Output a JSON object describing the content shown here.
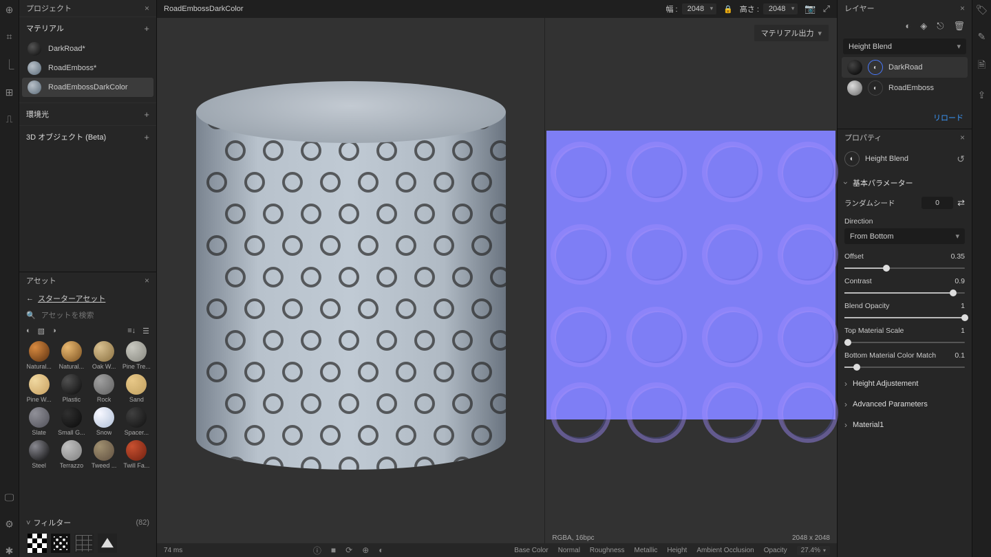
{
  "project": {
    "title": "プロジェクト",
    "materials_header": "マテリアル",
    "materials": [
      {
        "name": "DarkRoad*",
        "swatch": "dark"
      },
      {
        "name": "RoadEmboss*",
        "swatch": "slate"
      },
      {
        "name": "RoadEmbossDarkColor",
        "swatch": "slate",
        "selected": true
      }
    ],
    "env_header": "環境光",
    "obj3d_header": "3D オブジェクト (Beta)"
  },
  "assets": {
    "title": "アセット",
    "back": "スターターアセット",
    "search_placeholder": "アセットを検索",
    "items": [
      {
        "name": "Natural...",
        "cls": "th-natural1"
      },
      {
        "name": "Natural...",
        "cls": "th-natural2"
      },
      {
        "name": "Oak W...",
        "cls": "th-oak"
      },
      {
        "name": "Pine Tre...",
        "cls": "th-pinetre"
      },
      {
        "name": "Pine W...",
        "cls": "th-pinew"
      },
      {
        "name": "Plastic",
        "cls": "th-plastic"
      },
      {
        "name": "Rock",
        "cls": "th-rock"
      },
      {
        "name": "Sand",
        "cls": "th-sand"
      },
      {
        "name": "Slate",
        "cls": "th-slate"
      },
      {
        "name": "Small G...",
        "cls": "th-smallg"
      },
      {
        "name": "Snow",
        "cls": "th-snow"
      },
      {
        "name": "Spacer...",
        "cls": "th-spacer"
      },
      {
        "name": "Steel",
        "cls": "th-steel"
      },
      {
        "name": "Terrazzo",
        "cls": "th-terrazzo"
      },
      {
        "name": "Tweed ...",
        "cls": "th-tweed"
      },
      {
        "name": "Twill Fa...",
        "cls": "th-twill"
      }
    ],
    "filters_label": "フィルター",
    "filters_count": "(82)"
  },
  "topbar": {
    "doc_name": "RoadEmbossDarkColor",
    "width_label": "幅 :",
    "width_val": "2048",
    "height_label": "高さ :",
    "height_val": "2048"
  },
  "viewport2d": {
    "material_output": "マテリアル出力",
    "pixel_format": "RGBA, 16bpc",
    "resolution": "2048 x 2048"
  },
  "bottombar": {
    "render_time": "74 ms",
    "channels": {
      "base_color": "Base Color",
      "normal": "Normal",
      "roughness": "Roughness",
      "metallic": "Metallic",
      "height": "Height",
      "ao": "Ambient Occlusion",
      "opacity": "Opacity"
    },
    "opacity_pct": "27.4%"
  },
  "layers": {
    "title": "レイヤー",
    "blend_mode": "Height Blend",
    "items": [
      {
        "name": "DarkRoad",
        "active": true,
        "dark": true,
        "selected_slot": true
      },
      {
        "name": "RoadEmboss",
        "active": false,
        "dark": false,
        "selected_slot": false
      }
    ],
    "reload": "リロード"
  },
  "properties": {
    "title": "プロパティ",
    "name": "Height Blend",
    "group_basic": "基本パラメーター",
    "random_seed_label": "ランダムシード",
    "random_seed_val": "0",
    "direction_label": "Direction",
    "direction_val": "From Bottom",
    "sliders": [
      {
        "label": "Offset",
        "val": "0.35",
        "pct": 35
      },
      {
        "label": "Contrast",
        "val": "0.9",
        "pct": 90
      },
      {
        "label": "Blend Opacity",
        "val": "1",
        "pct": 100
      },
      {
        "label": "Top Material Scale",
        "val": "1",
        "pct": 3
      },
      {
        "label": "Bottom Material Color Match",
        "val": "0.1",
        "pct": 10
      }
    ],
    "group_height_adj": "Height Adjustement",
    "group_advanced": "Advanced Parameters",
    "group_material1": "Material1"
  }
}
